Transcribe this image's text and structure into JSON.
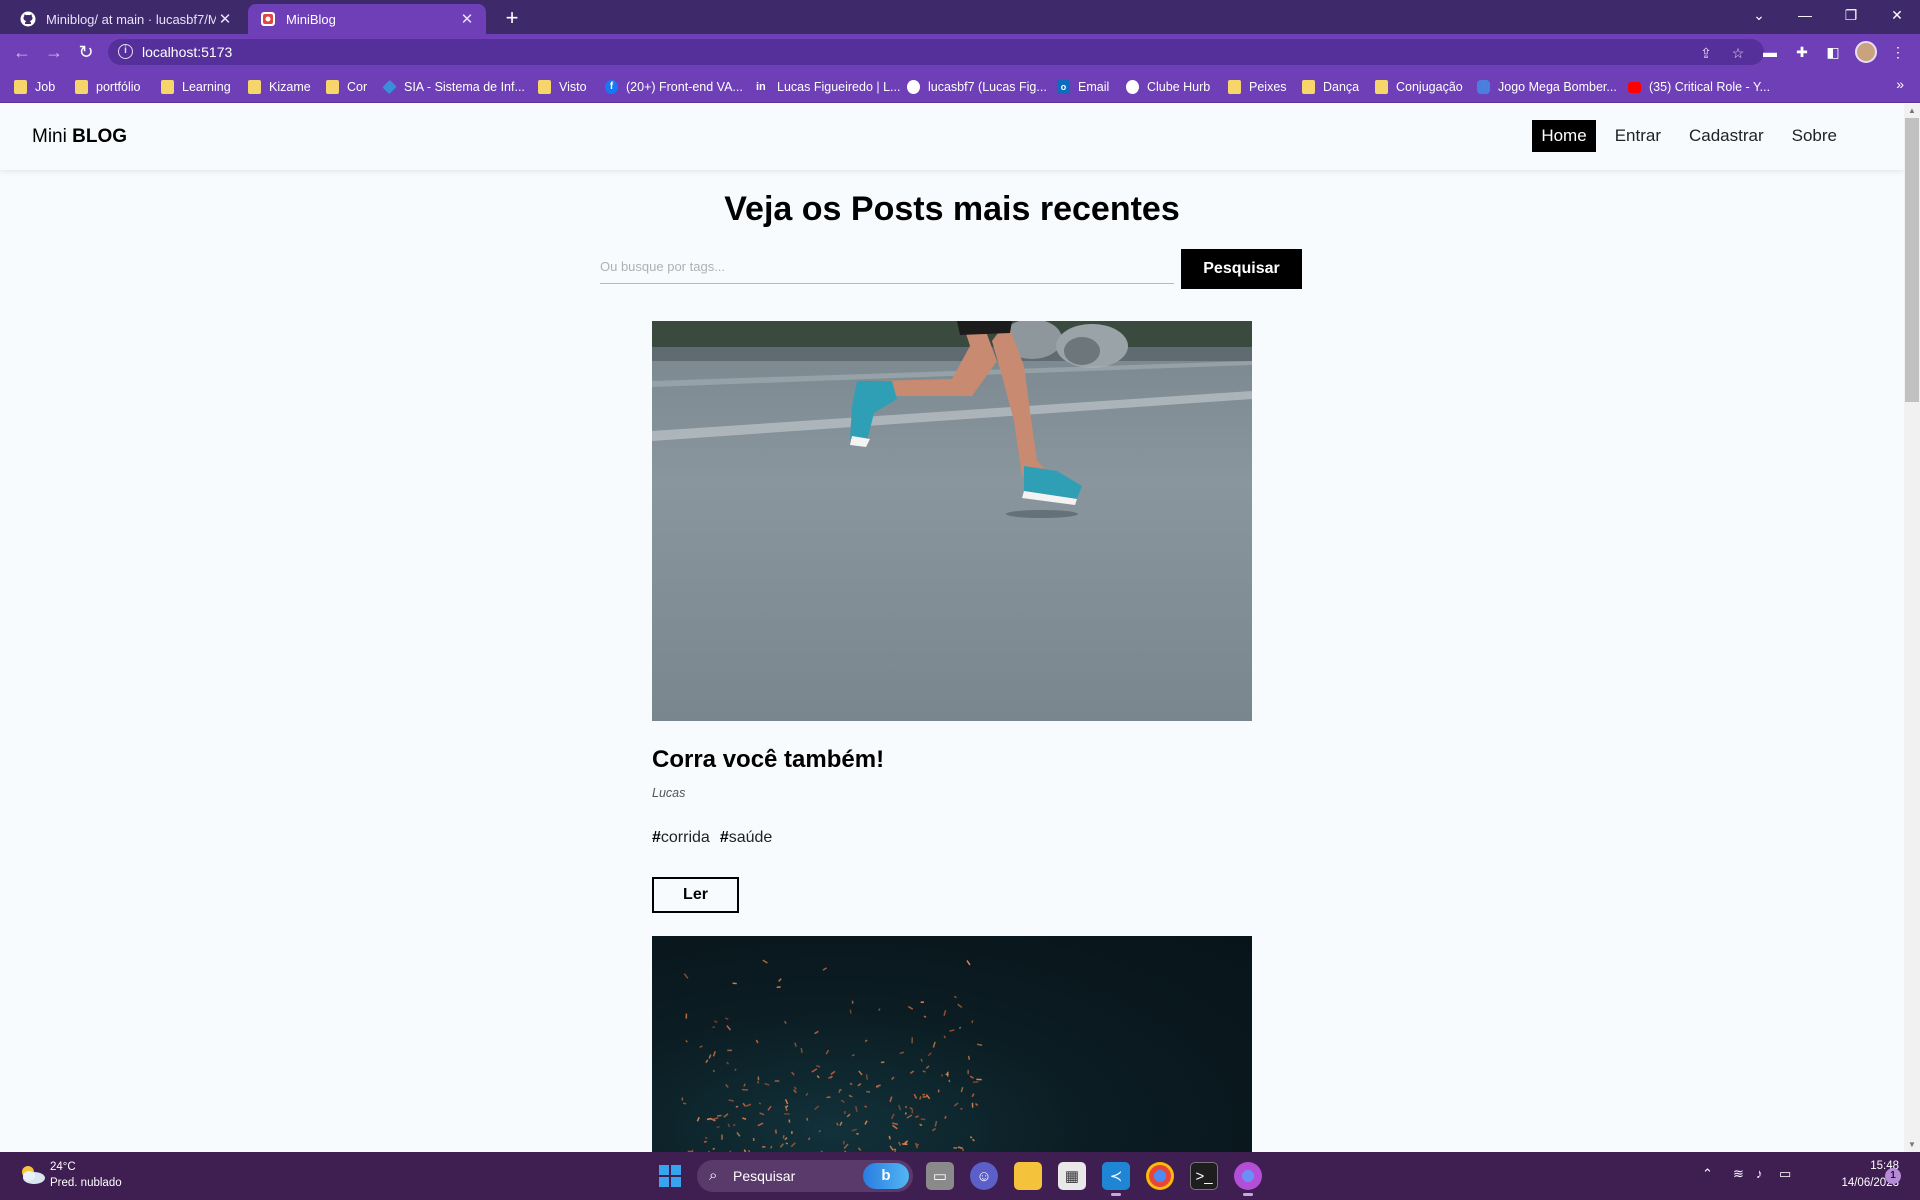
{
  "browser": {
    "tabs": [
      {
        "title": "Miniblog/ at main · lucasbf7/Mini",
        "icon": "github-icon"
      },
      {
        "title": "MiniBlog",
        "icon": "miniblog-icon"
      }
    ],
    "url": "localhost:5173",
    "bookmarks": [
      {
        "label": "Job",
        "icon": "folder-icon"
      },
      {
        "label": "portfólio",
        "icon": "folder-icon"
      },
      {
        "label": "Learning",
        "icon": "folder-icon"
      },
      {
        "label": "Kizame",
        "icon": "folder-icon"
      },
      {
        "label": "Cor",
        "icon": "folder-icon"
      },
      {
        "label": "SIA - Sistema de Inf...",
        "icon": "sia-icon"
      },
      {
        "label": "Visto",
        "icon": "folder-icon"
      },
      {
        "label": "(20+) Front-end VA...",
        "icon": "facebook-icon"
      },
      {
        "label": "Lucas Figueiredo | L...",
        "icon": "linkedin-icon"
      },
      {
        "label": "lucasbf7 (Lucas Fig...",
        "icon": "github-icon"
      },
      {
        "label": "Email",
        "icon": "outlook-icon"
      },
      {
        "label": "Clube Hurb",
        "icon": "hurb-icon"
      },
      {
        "label": "Peixes",
        "icon": "folder-icon"
      },
      {
        "label": "Dança",
        "icon": "folder-icon"
      },
      {
        "label": "Conjugação",
        "icon": "folder-icon"
      },
      {
        "label": "Jogo Mega Bomber...",
        "icon": "game-icon"
      },
      {
        "label": "(35) Critical Role - Y...",
        "icon": "youtube-icon"
      }
    ],
    "bookmarks_more": "»"
  },
  "site": {
    "brand_light": "Mini",
    "brand_bold": "BLOG",
    "nav": [
      {
        "label": "Home",
        "active": true
      },
      {
        "label": "Entrar",
        "active": false
      },
      {
        "label": "Cadastrar",
        "active": false
      },
      {
        "label": "Sobre",
        "active": false
      }
    ]
  },
  "home": {
    "heading": "Veja os Posts mais recentes",
    "search_placeholder": "Ou busque por tags...",
    "search_button": "Pesquisar"
  },
  "posts": [
    {
      "title": "Corra você também!",
      "author": "Lucas",
      "tags": [
        "corrida",
        "saúde"
      ],
      "read_label": "Ler",
      "image": "runner-legs-on-road-photo"
    },
    {
      "image": "sparks-night-photo"
    }
  ],
  "taskbar": {
    "weather_temp": "24°C",
    "weather_desc": "Pred. nublado",
    "search_label": "Pesquisar",
    "time": "15:48",
    "date": "14/06/2023",
    "notifications": "1"
  },
  "colors": {
    "chrome_dark": "#3e2a6b",
    "chrome_accent": "#6e3fb7",
    "page_bg": "#f8fbfd",
    "taskbar": "#3f1e52"
  }
}
